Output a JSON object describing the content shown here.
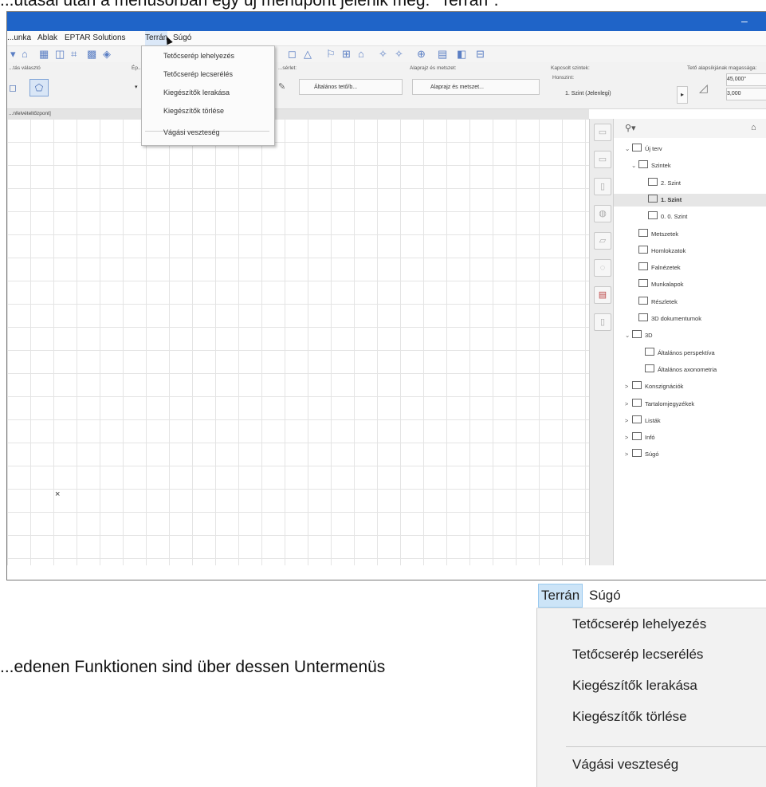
{
  "document": {
    "header_fragment": "...utasai után a menüsorban egy új menüpont jelenik meg: \"Terrán\".",
    "caption_fragment": "...edenen Funktionen sind über dessen Untermenüs"
  },
  "titlebar": {
    "minimize": "–"
  },
  "menubar": {
    "items": [
      "...unka",
      "Ablak",
      "EPTAR Solutions",
      "Terrán",
      "Súgó"
    ]
  },
  "infobox": {
    "labels": [
      "...tás választó",
      "Ép...",
      "...sérlet:",
      "Alaprajz és metszet:",
      "Kapcsolt szintek:",
      "Tető alapsíkjának magassága:"
    ],
    "general_roof": "Általános tető/b...",
    "floorplan_section": "Alaprajz és metszet...",
    "home_label": "Honszint:",
    "story_value": "1. Szint (Jelenlegi)",
    "angle_value": "45,000°",
    "height_value": "3,000"
  },
  "tab": {
    "label": "...nfelvételtőzpont]"
  },
  "canvas": {
    "origin_mark": "×"
  },
  "navigator": {
    "tree": [
      {
        "label": "Új terv",
        "chev": "⌄"
      },
      {
        "label": "Szintek",
        "chev": "⌄"
      },
      {
        "label": "2. Szint",
        "chev": ""
      },
      {
        "label": "1. Szint",
        "chev": ""
      },
      {
        "label": "0. 0. Szint",
        "chev": ""
      },
      {
        "label": "Metszetek",
        "chev": ""
      },
      {
        "label": "Homlokzatok",
        "chev": ""
      },
      {
        "label": "Falnézetek",
        "chev": ""
      },
      {
        "label": "Munkalapok",
        "chev": ""
      },
      {
        "label": "Részletek",
        "chev": ""
      },
      {
        "label": "3D dokumentumok",
        "chev": ""
      },
      {
        "label": "3D",
        "chev": "⌄"
      },
      {
        "label": "Általános perspektíva",
        "chev": ""
      },
      {
        "label": "Általános axonometria",
        "chev": ""
      },
      {
        "label": "Konszignációk",
        "chev": ">"
      },
      {
        "label": "Tartalomjegyzékek",
        "chev": ">"
      },
      {
        "label": "Listák",
        "chev": ">"
      },
      {
        "label": "Infó",
        "chev": ">"
      },
      {
        "label": "Súgó",
        "chev": ">"
      }
    ],
    "selected_index": 3
  },
  "terran_menu": {
    "items": [
      "Tetőcserép lehelyezés",
      "Tetőcserép lecserélés",
      "Kiegészítők lerakása",
      "Kiegészítők törlése",
      "Vágási veszteség"
    ]
  },
  "zoom": {
    "menubar": {
      "terran": "Terrán",
      "sugo": "Súgó"
    },
    "items": [
      "Tetőcserép lehelyezés",
      "Tetőcserép lecserélés",
      "Kiegészítők lerakása",
      "Kiegészítők törlése",
      "Vágási veszteség"
    ]
  }
}
